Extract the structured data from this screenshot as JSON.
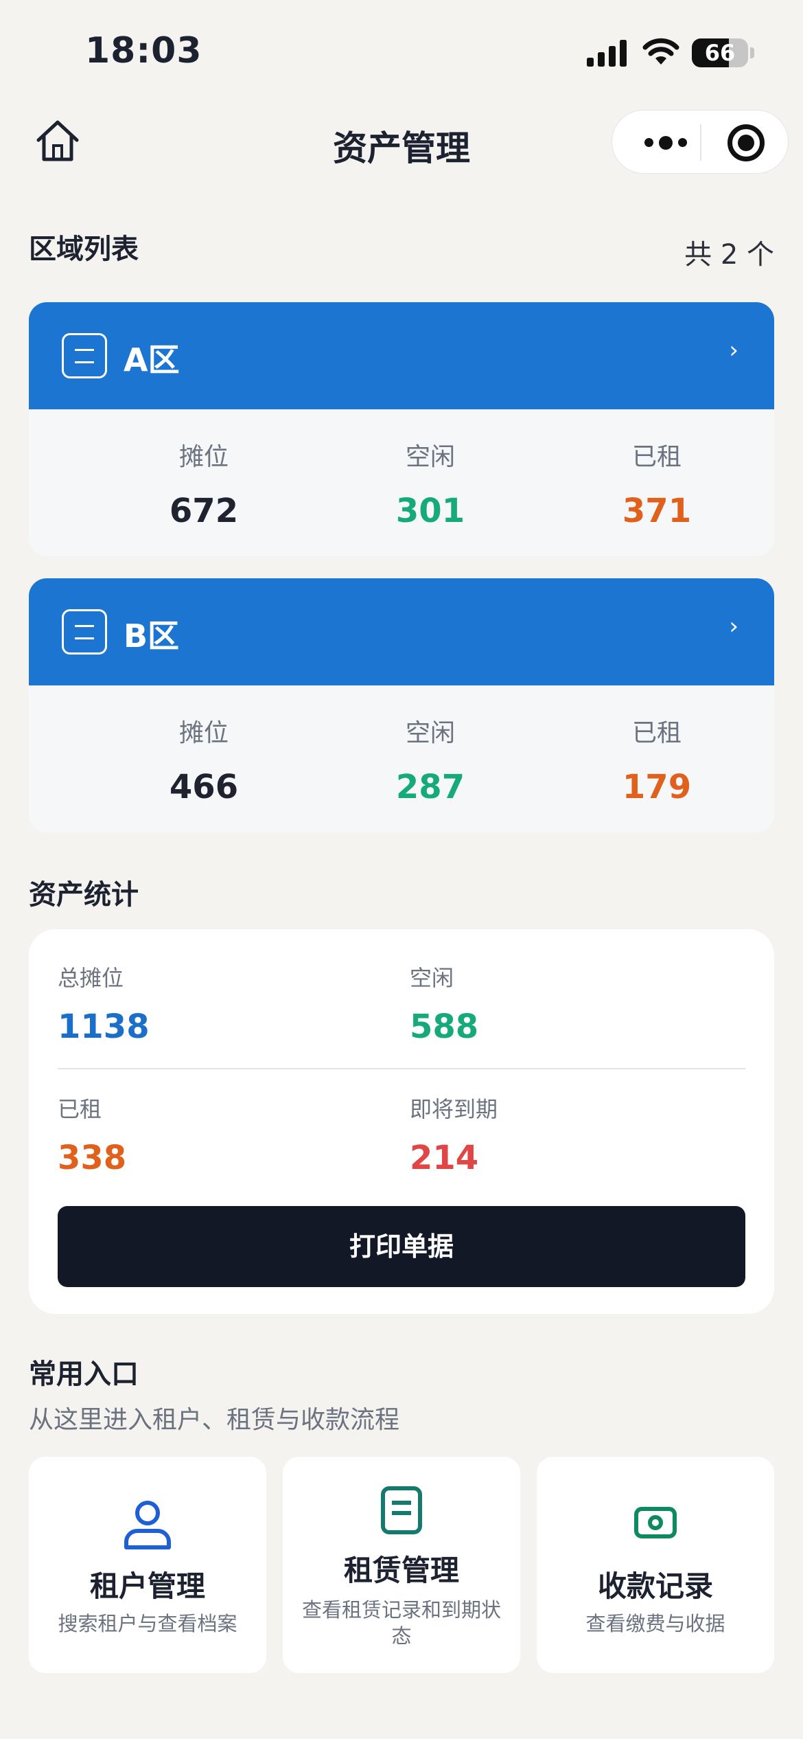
{
  "status_bar": {
    "time": "18:03",
    "battery": "66",
    "battery_level": 0.66
  },
  "nav": {
    "title": "资产管理",
    "home_icon": "home-icon",
    "more_icon": "more-dots-icon",
    "close_icon": "record-target-icon"
  },
  "areas_section": {
    "title": "区域列表",
    "count_text": "共 2 个"
  },
  "areas": [
    {
      "name": "A区",
      "stats": [
        {
          "label": "摊位",
          "value": "672"
        },
        {
          "label": "空闲",
          "value": "301"
        },
        {
          "label": "已租",
          "value": "371"
        }
      ]
    },
    {
      "name": "B区",
      "stats": [
        {
          "label": "摊位",
          "value": "466"
        },
        {
          "label": "空闲",
          "value": "287"
        },
        {
          "label": "已租",
          "value": "179"
        }
      ]
    }
  ],
  "chevron": "›",
  "stats_section": {
    "title": "资产统计",
    "total_label": "总摊位",
    "total_value": "1138",
    "idle_label": "空闲",
    "idle_value": "588",
    "rented_label": "已租",
    "rented_value": "338",
    "expiring_label": "即将到期",
    "expiring_value": "214",
    "print_button": "打印单据"
  },
  "shortcuts": {
    "title": "常用入口",
    "subtitle": "从这里进入租户、租赁与收款流程",
    "items": [
      {
        "title": "租户管理",
        "desc": "搜索租户与查看档案",
        "icon": "user-icon"
      },
      {
        "title": "租赁管理",
        "desc": "查看租赁记录和到期状态",
        "icon": "document-icon"
      },
      {
        "title": "收款记录",
        "desc": "查看缴费与收据",
        "icon": "cash-icon"
      }
    ]
  },
  "colors": {
    "primary_blue": "#1b75d1",
    "idle_green": "#16a97a",
    "rented_orange": "#e0611c",
    "expiring_red": "#e04646",
    "button_dark": "#121826"
  }
}
